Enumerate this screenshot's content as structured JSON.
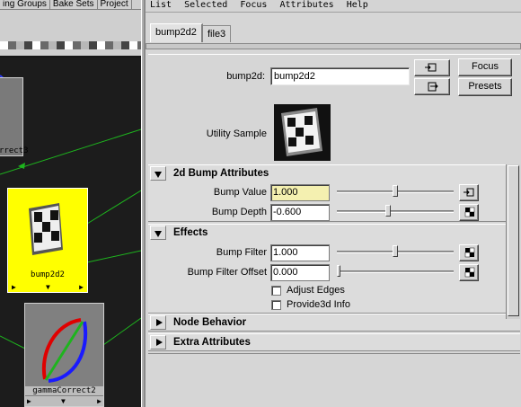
{
  "graph": {
    "tabs": [
      "ing Groups",
      "Bake Sets",
      "Project"
    ],
    "nodes": {
      "top_node": {
        "label": "rrect3"
      },
      "bump_node": {
        "label": "bump2d2"
      },
      "gamma_node": {
        "label": "gammaCorrect2"
      }
    },
    "colors": {
      "background": "#1c1c1c",
      "selected_node": "#ffff00",
      "connection": "#1eb41e"
    }
  },
  "menubar": {
    "items": [
      "List",
      "Selected",
      "Focus",
      "Attributes",
      "Help"
    ]
  },
  "tabs": [
    {
      "label": "bump2d2",
      "active": true
    },
    {
      "label": "file3",
      "active": false
    }
  ],
  "header": {
    "node_type_label": "bump2d:",
    "node_name_value": "bump2d2",
    "focus_button": "Focus",
    "presets_button": "Presets",
    "utility_sample_label": "Utility Sample"
  },
  "sections": {
    "bump2d": {
      "title": "2d Bump Attributes",
      "expanded": true,
      "bump_value": {
        "label": "Bump Value",
        "value": "1.000",
        "slider_fraction": 0.5
      },
      "bump_depth": {
        "label": "Bump Depth",
        "value": "-0.600",
        "slider_fraction": 0.44
      }
    },
    "effects": {
      "title": "Effects",
      "expanded": true,
      "bump_filter": {
        "label": "Bump Filter",
        "value": "1.000",
        "slider_fraction": 0.5
      },
      "bump_filter_offset": {
        "label": "Bump Filter Offset",
        "value": "0.000",
        "slider_fraction": 0.0
      },
      "adjust_edges": {
        "label": "Adjust Edges",
        "checked": false
      },
      "provide3d_info": {
        "label": "Provide3d Info",
        "checked": false
      }
    },
    "node_behavior": {
      "title": "Node Behavior",
      "expanded": false
    },
    "extra_attributes": {
      "title": "Extra Attributes",
      "expanded": false
    }
  }
}
